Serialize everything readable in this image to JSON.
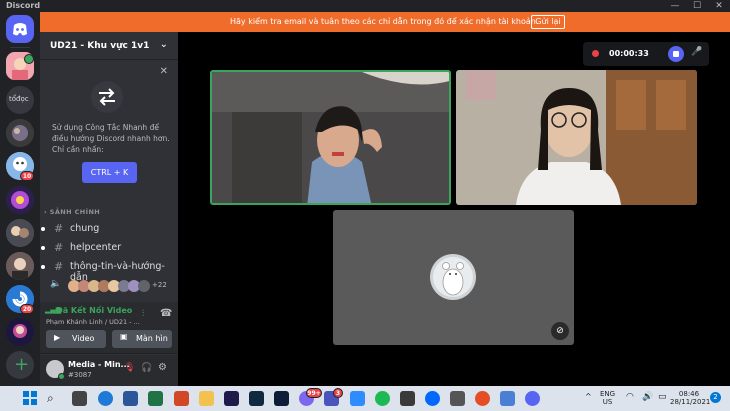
{
  "window": {
    "title": "Discord",
    "controls": [
      "—",
      "☐",
      "✕"
    ]
  },
  "banner": {
    "message": "Hãy kiểm tra email và tuân theo các chỉ dẫn trong đó để xác nhận tài khoản.",
    "button": "Gửi lại"
  },
  "guilds": {
    "items": [
      {
        "name": "home",
        "label": ""
      },
      {
        "name": "guild-1",
        "label": ""
      },
      {
        "name": "guild-todoc",
        "label": "tổđọc"
      },
      {
        "name": "guild-3",
        "label": ""
      },
      {
        "name": "guild-4",
        "label": ""
      },
      {
        "name": "guild-5",
        "label": ""
      },
      {
        "name": "guild-6",
        "label": ""
      },
      {
        "name": "guild-7",
        "label": ""
      },
      {
        "name": "guild-8",
        "label": ""
      },
      {
        "name": "guild-9",
        "label": ""
      }
    ],
    "badges": [
      "10",
      "20"
    ]
  },
  "server": {
    "name": "UD21 - Khu vực 1v1"
  },
  "tip": {
    "text": "Sử dụng Công Tắc Nhanh để điều hướng Discord nhanh hơn. Chỉ cần nhấn:",
    "shortcut": "CTRL + K"
  },
  "category": "SẢNH CHÍNH",
  "channels": [
    {
      "label": "chung"
    },
    {
      "label": "helpcenter"
    },
    {
      "label": "thông-tin-và-hướng-dẫn"
    }
  ],
  "voice_users": {
    "count": "+22"
  },
  "voice_panel": {
    "status": "Đã Kết Nối Video",
    "channel": "Phạm Khánh Linh / UD21 - ...",
    "video_button": "Video",
    "screen_button": "Màn hìn"
  },
  "user": {
    "name": "Media - Min...",
    "tag": "#3087"
  },
  "recording": {
    "time": "00:00:33"
  },
  "taskbar": {
    "badge_mail": "99+",
    "badge_app": "3",
    "lang": "ENG",
    "region": "US",
    "time": "08:46",
    "date": "28/11/2021",
    "notif": "2"
  },
  "colors": {
    "accent": "#5865f2",
    "banner": "#f06c2b",
    "connected": "#3ba55d",
    "speaking": "#3ba55d",
    "danger": "#ed4245"
  }
}
